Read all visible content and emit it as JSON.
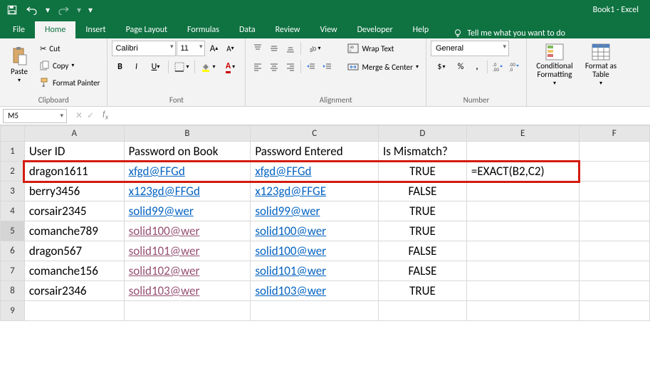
{
  "app": {
    "title": "Book1 - Excel"
  },
  "qat": {
    "save": "save-icon",
    "undo": "undo-icon",
    "redo": "redo-icon"
  },
  "tabs": [
    "File",
    "Home",
    "Insert",
    "Page Layout",
    "Formulas",
    "Data",
    "Review",
    "View",
    "Developer",
    "Help"
  ],
  "active_tab": "Home",
  "tell_me": "Tell me what you want to do",
  "ribbon": {
    "clipboard": {
      "label": "Clipboard",
      "paste": "Paste",
      "cut": "Cut",
      "copy": "Copy",
      "format_painter": "Format Painter"
    },
    "font": {
      "label": "Font",
      "name": "Calibri",
      "size": "11"
    },
    "alignment": {
      "label": "Alignment",
      "wrap": "Wrap Text",
      "merge": "Merge & Center"
    },
    "number": {
      "label": "Number",
      "format": "General"
    },
    "styles": {
      "cond": "Conditional Formatting",
      "table": "Format as Table"
    }
  },
  "name_box": "M5",
  "formula_bar": "",
  "sheet": {
    "columns": [
      "A",
      "B",
      "C",
      "D",
      "E",
      "F"
    ],
    "headers": {
      "A": "User ID",
      "B": "Password on Book",
      "C": "Password Entered",
      "D": "Is Mismatch?"
    },
    "rows": [
      {
        "n": 2,
        "A": "dragon1611",
        "B": "xfgd@FFGd",
        "C": "xfgd@FFGd",
        "D": "TRUE",
        "E": "=EXACT(B2,C2)",
        "blink": true,
        "clink": true,
        "highlight": true
      },
      {
        "n": 3,
        "A": "berry3456",
        "B": "x123gd@FFGd",
        "C": "x123gd@FFGE",
        "D": "FALSE",
        "blink": true,
        "clink": true
      },
      {
        "n": 4,
        "A": "corsair2345",
        "B": "solid99@wer",
        "C": "solid99@wer",
        "D": "TRUE",
        "blink": true,
        "clink": true
      },
      {
        "n": 5,
        "A": "comanche789",
        "B": "solid100@wer",
        "C": "solid100@wer",
        "D": "TRUE",
        "bvlink": true,
        "clink": true,
        "sel": true
      },
      {
        "n": 6,
        "A": "dragon567",
        "B": "solid101@wer",
        "C": "solid100@wer",
        "D": "FALSE",
        "bvlink": true,
        "clink": true
      },
      {
        "n": 7,
        "A": "comanche156",
        "B": "solid102@wer",
        "C": "solid101@wer",
        "D": "FALSE",
        "bvlink": true,
        "clink": true
      },
      {
        "n": 8,
        "A": "corsair2346",
        "B": "solid103@wer",
        "C": "solid103@wer",
        "D": "TRUE",
        "bvlink": true,
        "clink": true
      },
      {
        "n": 9
      }
    ]
  }
}
